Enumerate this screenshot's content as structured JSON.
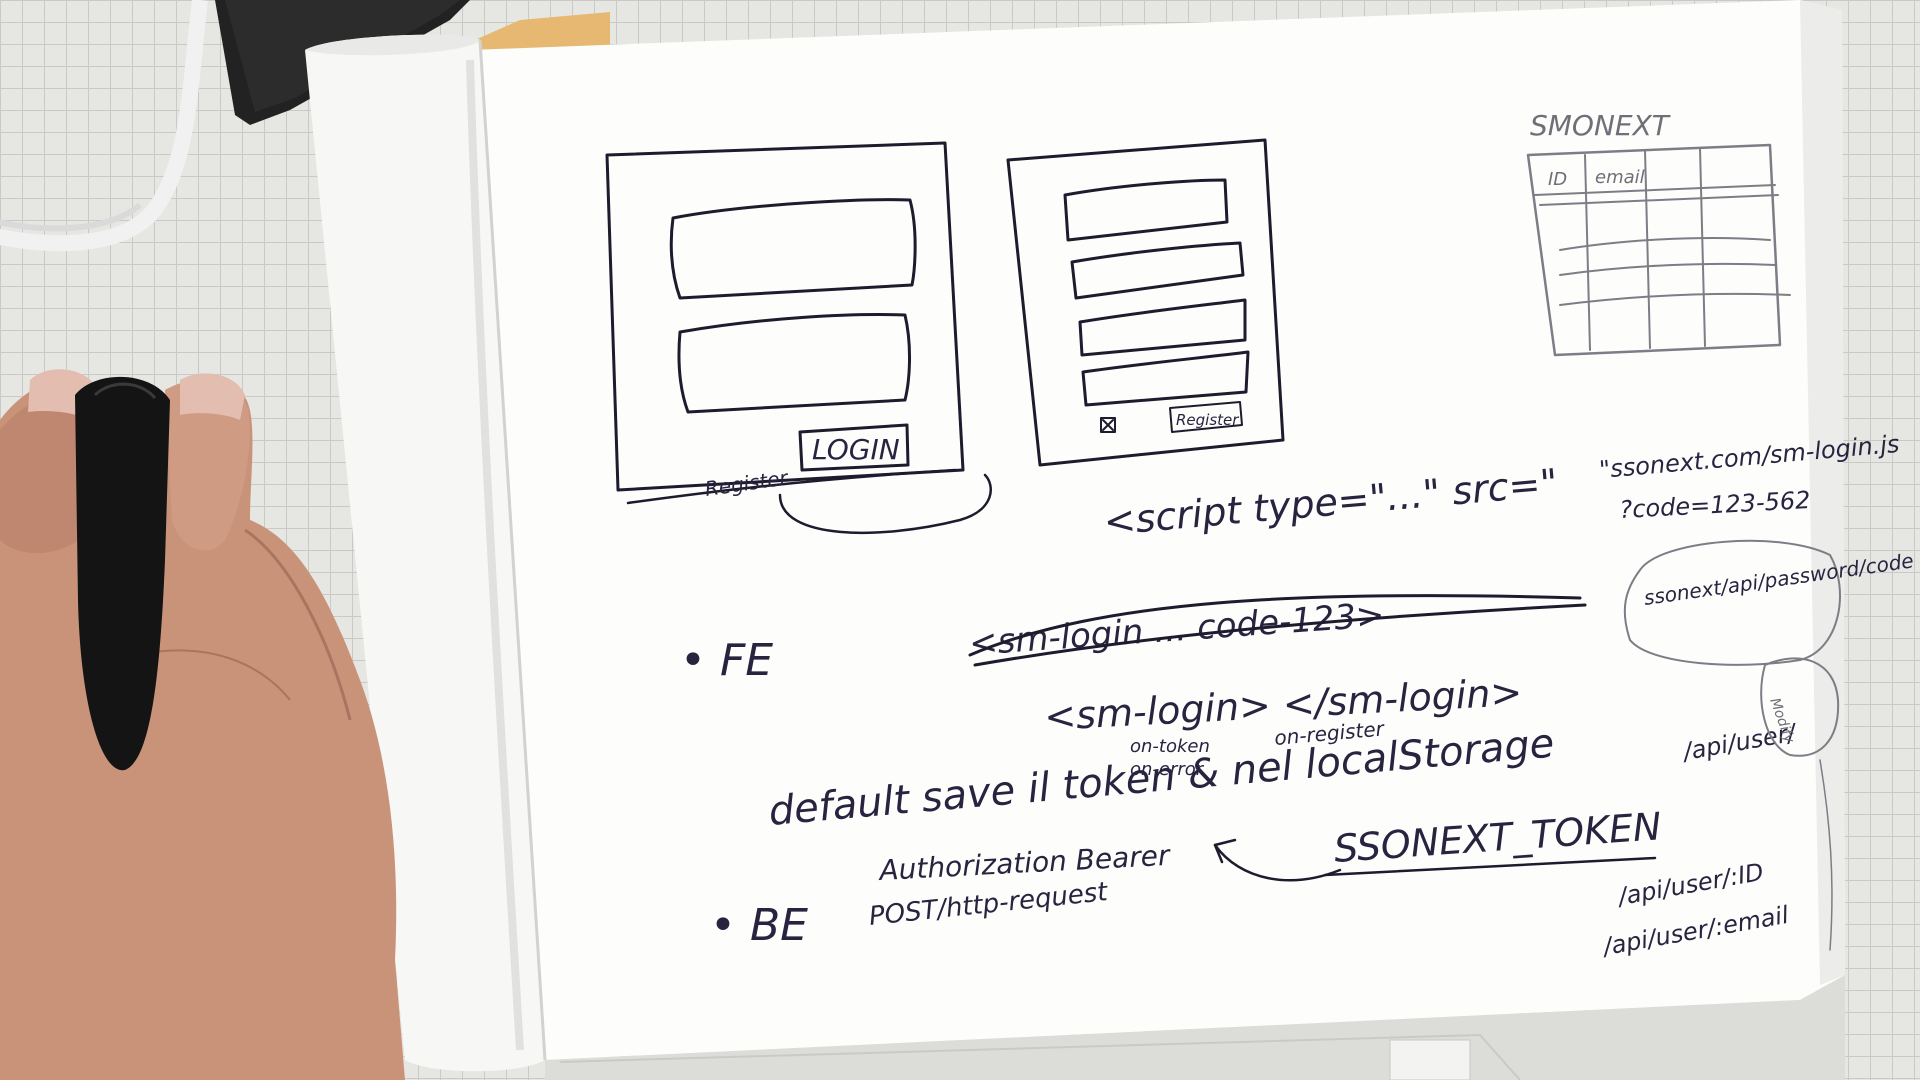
{
  "notebook": {
    "title": "SMONEXT",
    "table_headers": [
      "ID",
      "email"
    ],
    "login_button": "LOGIN",
    "register_link": "Register",
    "register_button": "Register",
    "script_tag": "<script type=\"...\" src=\"",
    "script_src": "\"ssonext.com/sm-login.js",
    "script_query": "?code=123-562",
    "api_bubble": "ssonext/api/password/code",
    "fe_bullet": "• FE",
    "crossed_out": "<sm-login ... code-123>",
    "component_tag": "<sm-login> </sm-login>",
    "event_on_token": "on-token",
    "event_on_error": "on-error",
    "event_on_register": "on-register",
    "default_note": "default save il token & nel localStorage",
    "auth_bearer": "Authorization Bearer",
    "token_name": "SSONEXT_TOKEN",
    "be_bullet": "• BE",
    "be_request": "POST/http-request",
    "api_user": "/api/user/",
    "api_user_id": "/api/user/:ID",
    "api_user_email": "/api/user/:email",
    "side_bubble": "Modify"
  },
  "colors": {
    "paper": "#fdfdfc",
    "ink": "#1f1b2e",
    "pencil": "#7d7d86",
    "desk_grid": "#e6e6e3",
    "skin": "#c9937a",
    "mouse": "#141414"
  }
}
